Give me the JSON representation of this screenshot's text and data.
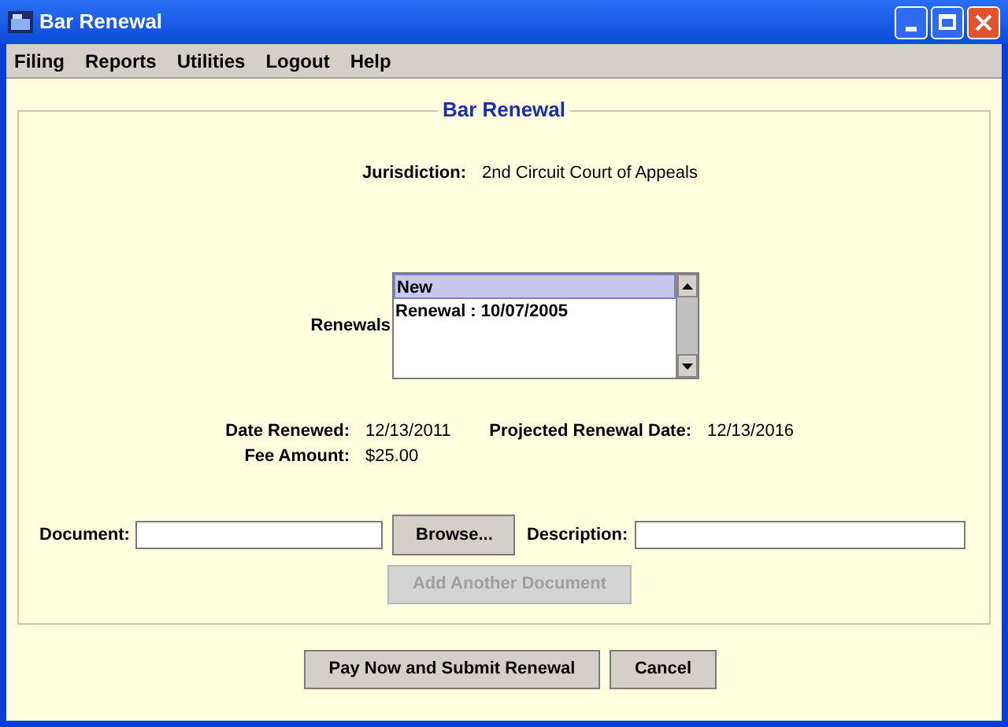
{
  "window": {
    "title": "Bar Renewal"
  },
  "menu": [
    "Filing",
    "Reports",
    "Utilities",
    "Logout",
    "Help"
  ],
  "panel": {
    "title": "Bar Renewal",
    "jurisdiction": {
      "label": "Jurisdiction:",
      "value": "2nd Circuit Court of Appeals"
    },
    "renewals": {
      "label": "Renewals",
      "items": [
        {
          "text": "New",
          "selected": true
        },
        {
          "text": "Renewal : 10/07/2005",
          "selected": false
        }
      ]
    },
    "date_renewed": {
      "label": "Date Renewed:",
      "value": "12/13/2011"
    },
    "projected_renewal_date": {
      "label": "Projected Renewal Date:",
      "value": "12/13/2016"
    },
    "fee_amount": {
      "label": "Fee Amount:",
      "value": "$25.00"
    },
    "document": {
      "label": "Document:",
      "browse": "Browse...",
      "description_label": "Description:"
    },
    "add_button": {
      "label": "Add Another Document",
      "disabled": true
    }
  },
  "buttons": [
    {
      "label": "Pay Now and Submit Renewal",
      "disabled": false
    },
    {
      "label": "Cancel",
      "disabled": false
    }
  ]
}
